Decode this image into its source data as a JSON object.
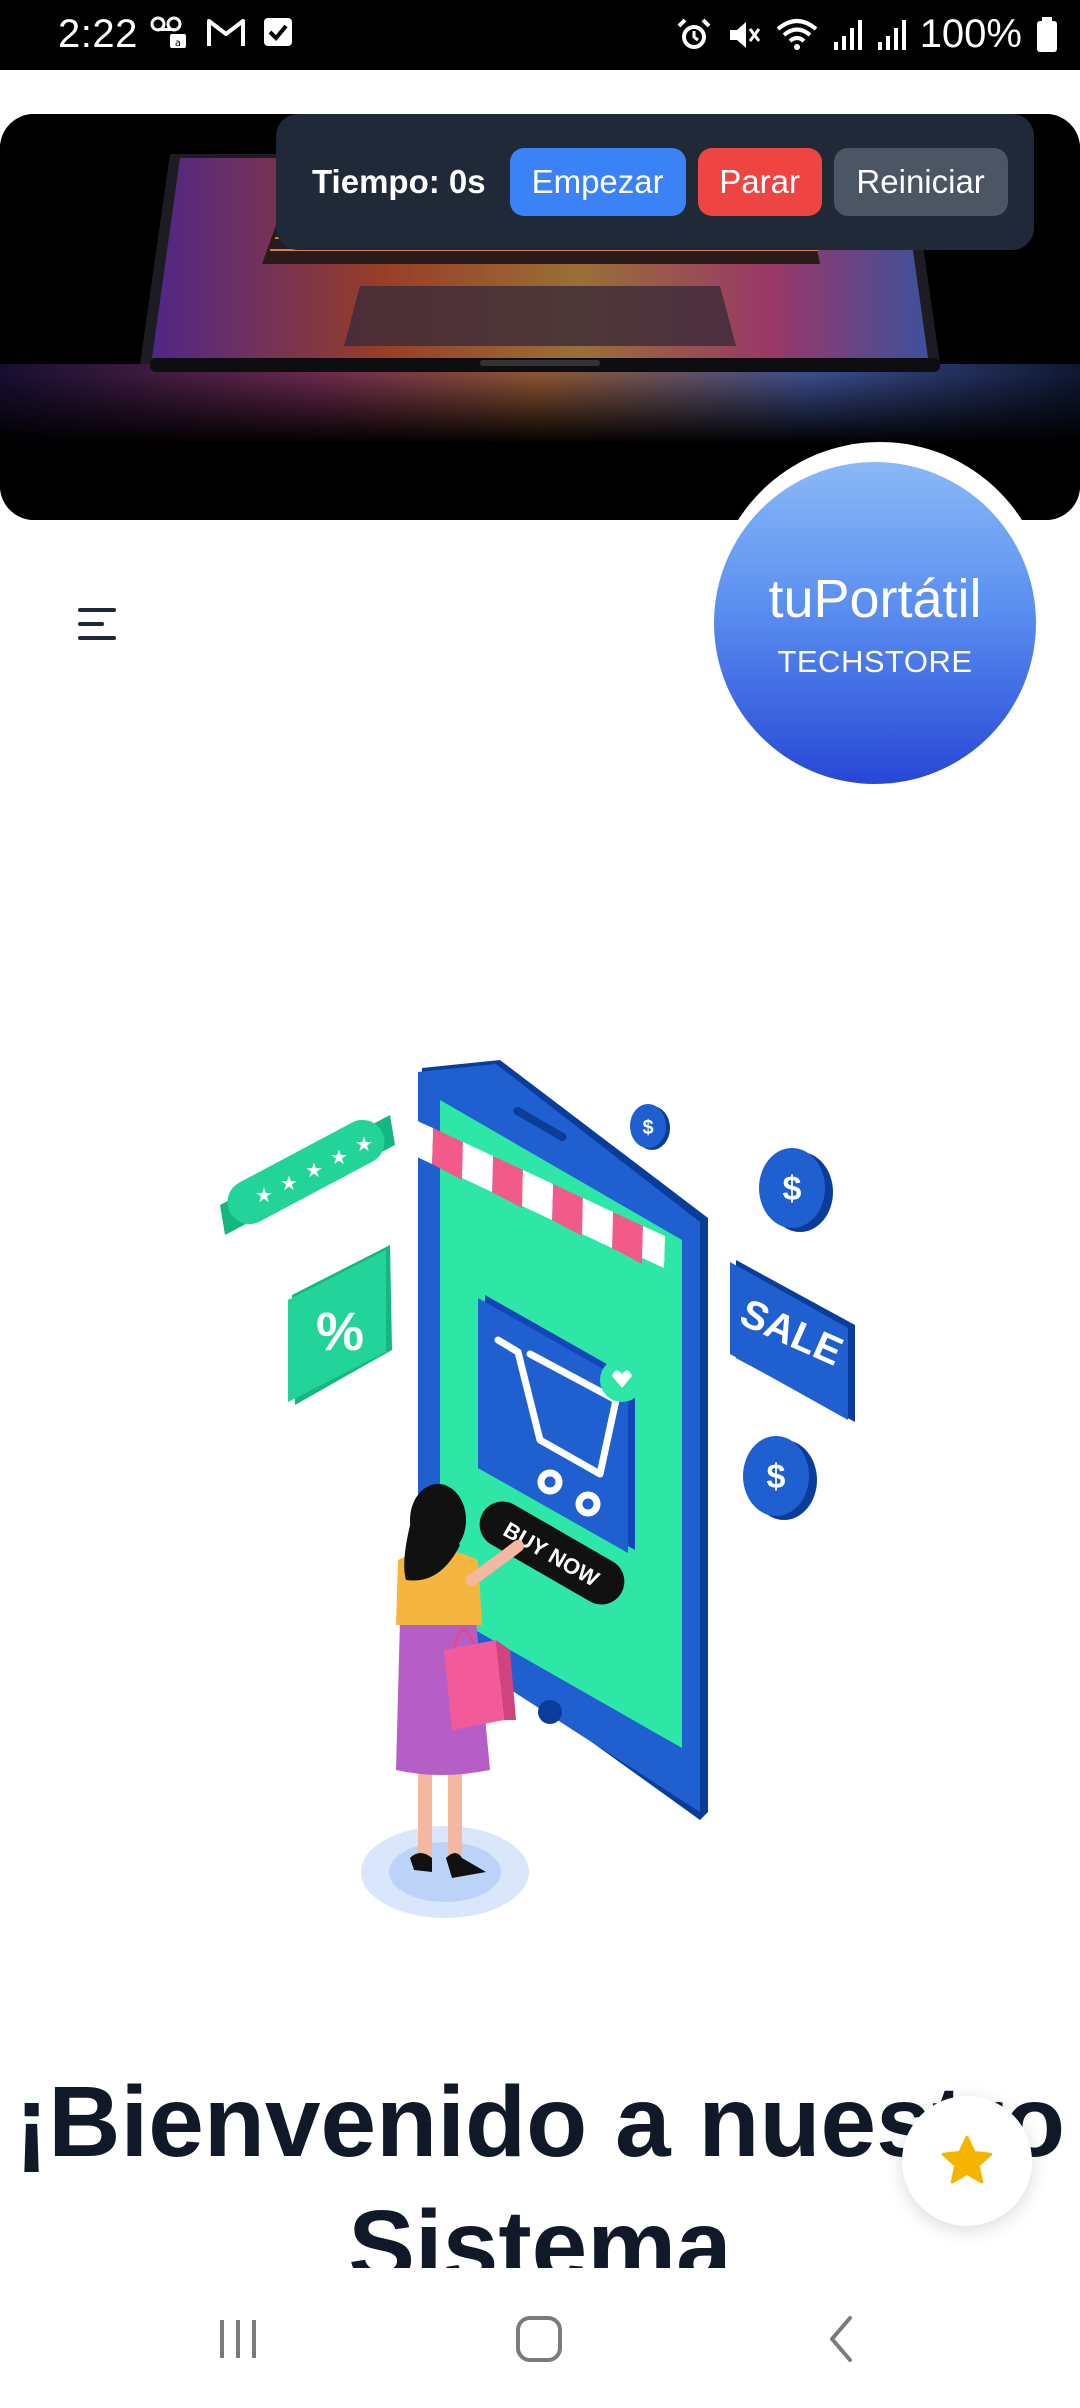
{
  "status_bar": {
    "time": "2:22",
    "battery_text": "100%",
    "left_icons": [
      "voicemail-lock-icon",
      "gmail-icon",
      "checkbox-app-icon"
    ],
    "right_icons": [
      "alarm-icon",
      "mute-icon",
      "wifi-icon",
      "signal-icon",
      "signal-icon-2",
      "battery-icon"
    ]
  },
  "timer": {
    "label": "Tiempo: 0s",
    "start_label": "Empezar",
    "stop_label": "Parar",
    "reset_label": "Reiniciar"
  },
  "logo": {
    "title": "tuPortátil",
    "subtitle": "TECHSTORE"
  },
  "illustration": {
    "buy_now": "BUY NOW",
    "sale": "SALE",
    "percent": "%",
    "dollar": "$"
  },
  "main": {
    "headline": "¡Bienvenido a nuestro Sistema"
  },
  "colors": {
    "start": "#3b82f6",
    "stop": "#ef4444",
    "reset": "#4b5563",
    "panel": "#1f2937",
    "logo_top": "#8ab8f8",
    "logo_bottom": "#2747d6",
    "star": "#f5b400"
  }
}
